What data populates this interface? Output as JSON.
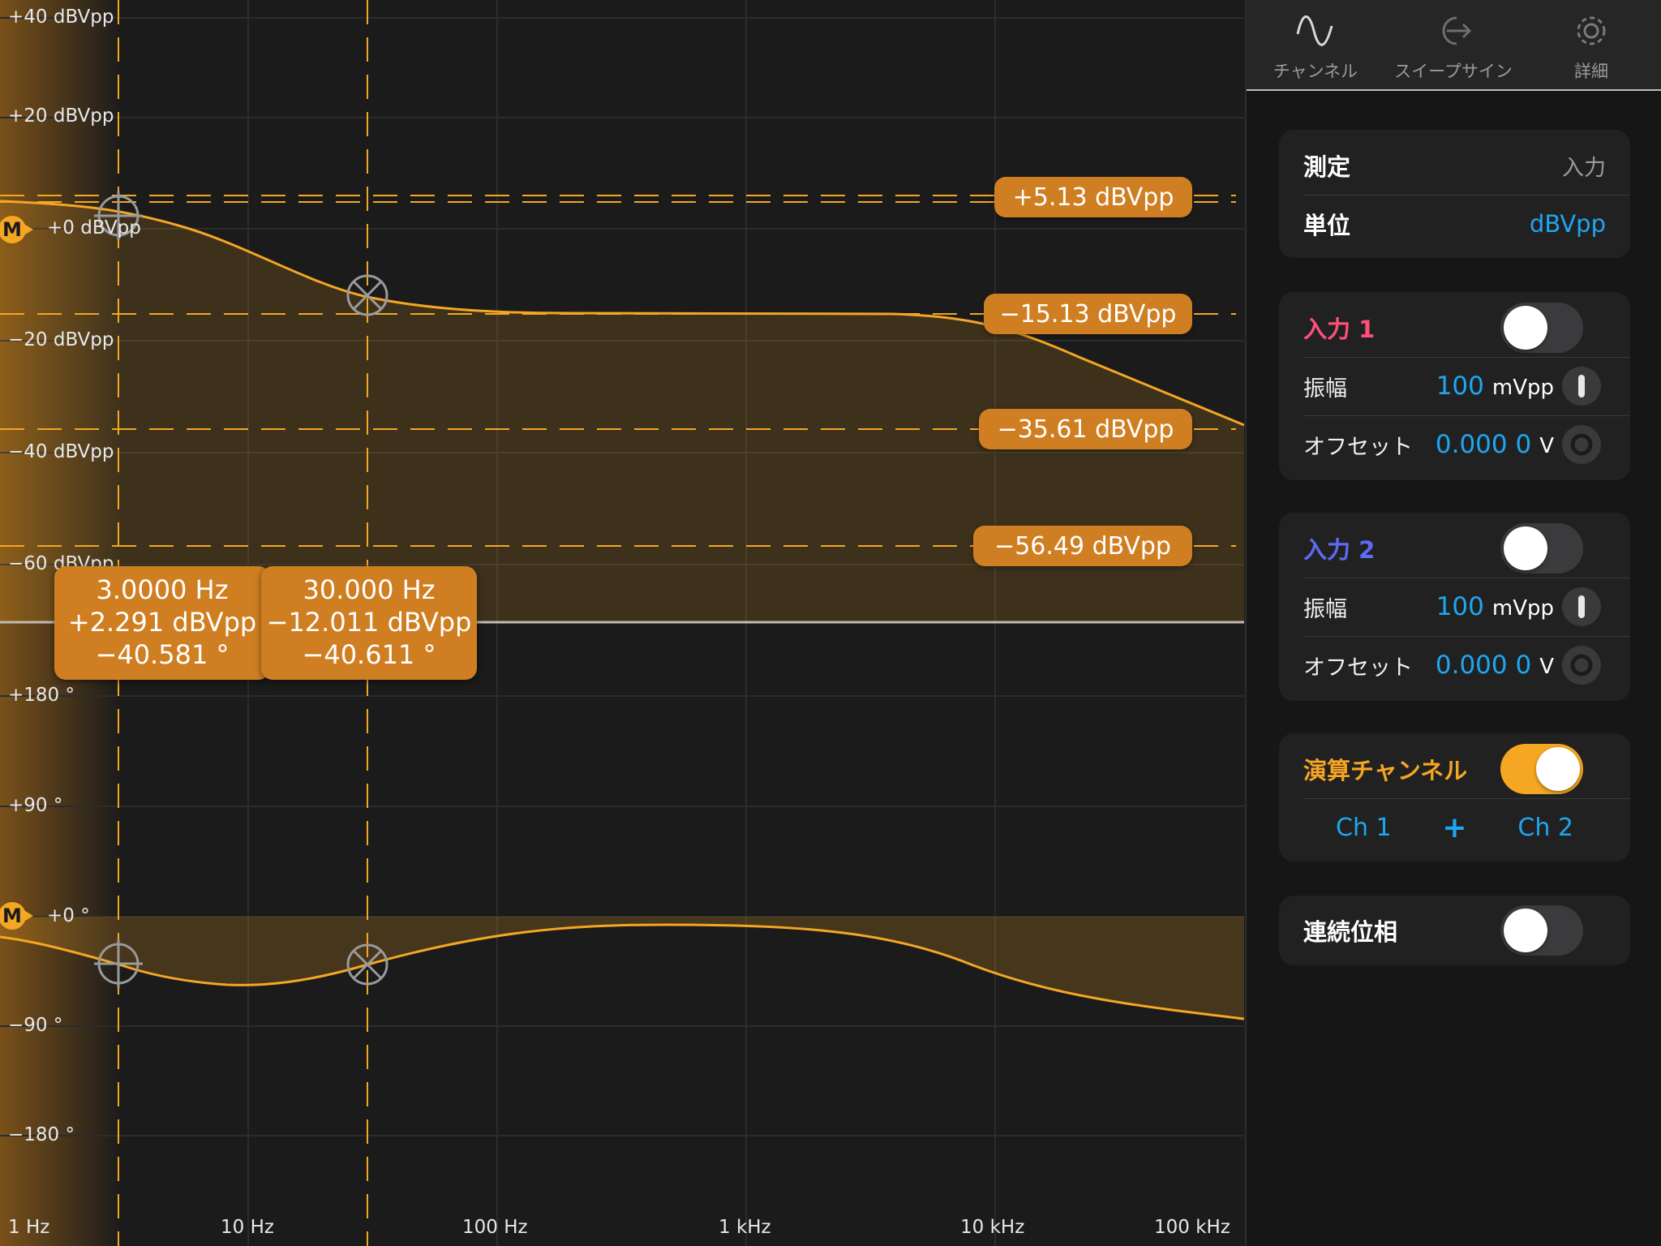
{
  "colors": {
    "accent": "#f5a623",
    "pill": "#cf7f22",
    "blue": "#1ea7f0",
    "input1": "#ff4f79",
    "input2": "#5b6cf5"
  },
  "plot": {
    "amplitude_labels": [
      "+40 dBVpp",
      "+20 dBVpp",
      "+0 dBVpp",
      "−20 dBVpp",
      "−40 dBVpp",
      "−60 dBVpp"
    ],
    "phase_labels": [
      "+180 °",
      "+90 °",
      "+0 °",
      "−90 °",
      "−180 °"
    ],
    "freq_labels": [
      "1 Hz",
      "10 Hz",
      "100 Hz",
      "1 kHz",
      "10 kHz",
      "100 kHz"
    ],
    "marker_letter": "M",
    "ref_pills": [
      "+5.13 dBVpp",
      "−15.13 dBVpp",
      "−35.61 dBVpp",
      "−56.49 dBVpp"
    ],
    "cursors": [
      {
        "freq": "3.0000 Hz",
        "amp": "+2.291 dBVpp",
        "phase": "−40.581 °"
      },
      {
        "freq": "30.000 Hz",
        "amp": "−12.011 dBVpp",
        "phase": "−40.611 °"
      }
    ]
  },
  "tabs": [
    {
      "label": "チャンネル",
      "icon": "sine-wave-icon"
    },
    {
      "label": "スイープサイン",
      "icon": "sweep-export-icon"
    },
    {
      "label": "詳細",
      "icon": "gear-icon"
    }
  ],
  "measure": {
    "title": "測定",
    "value": "入力",
    "unit_label": "単位",
    "unit_value": "dBVpp"
  },
  "input1": {
    "title": "入力 1",
    "enabled": false,
    "amp_label": "振幅",
    "amp_value": "100",
    "amp_unit": "mVpp",
    "offset_label": "オフセット",
    "offset_value": "0.000 0",
    "offset_unit": "V"
  },
  "input2": {
    "title": "入力 2",
    "enabled": false,
    "amp_label": "振幅",
    "amp_value": "100",
    "amp_unit": "mVpp",
    "offset_label": "オフセット",
    "offset_value": "0.000 0",
    "offset_unit": "V"
  },
  "math": {
    "title": "演算チャンネル",
    "enabled": true,
    "left": "Ch 1",
    "op": "+",
    "right": "Ch 2"
  },
  "phase_cont": {
    "title": "連続位相",
    "enabled": false
  }
}
